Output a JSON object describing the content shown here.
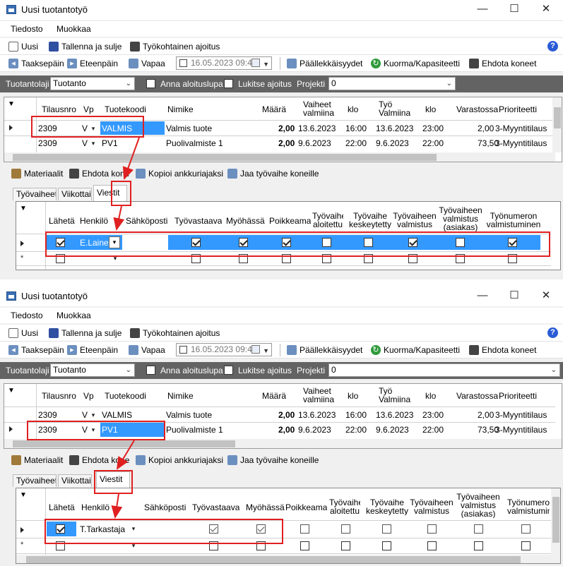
{
  "window": {
    "title": "Uusi tuotantotyö"
  },
  "menu": [
    "Tiedosto",
    "Muokkaa"
  ],
  "toolbar1": {
    "new": "Uusi",
    "save_close": "Tallenna ja sulje",
    "job_run": "Työkohtainen ajoitus"
  },
  "toolbar2": {
    "back": "Taaksepäin",
    "forward": "Eteenpäin",
    "free": "Vapaa",
    "date": "16.05.2023 09:40",
    "overlaps": "Päällekkäisyydet",
    "load": "Kuorma/Kapasiteetti",
    "suggest": "Ehdota koneet"
  },
  "filter": {
    "type_label": "Tuotantolaji",
    "type_value": "Tuotanto",
    "allow_start": "Anna aloituslupa",
    "lock_run": "Lukitse ajoitus",
    "project_label": "Projekti",
    "project_value": "0"
  },
  "main_grid": {
    "headers": {
      "order_no": "Tilausnro",
      "vp": "Vp",
      "product": "Tuotekoodi",
      "name": "Nimike",
      "qty": "Määrä",
      "phase_l1": "Vaiheet",
      "phase_l2": "valmiina",
      "time1": "klo",
      "work_l1": "Työ",
      "work_l2": "Valmiina",
      "time2": "klo",
      "stock": "Varastossa",
      "priority": "Prioriteetti"
    },
    "rows": [
      {
        "order_no": "2309",
        "vp": "V",
        "product": "VALMIS",
        "name": "Valmis tuote",
        "qty": "2,00",
        "phase_done": "13.6.2023",
        "time1": "16:00",
        "work_done": "13.6.2023",
        "time2": "23:00",
        "stock": "2,00",
        "priority": "3-Myyntitilaus"
      },
      {
        "order_no": "2309",
        "vp": "V",
        "product": "PV1",
        "name": "Puolivalmiste 1",
        "qty": "2,00",
        "phase_done": "9.6.2023",
        "time1": "22:00",
        "work_done": "9.6.2023",
        "time2": "22:00",
        "stock": "73,50",
        "priority": "3-Myyntitilaus"
      }
    ]
  },
  "toolbar3": {
    "materials": "Materiaalit",
    "suggest_machine": "Ehdota kone",
    "copy_anchor": "Kopioi ankkuriajaksi",
    "split_phase": "Jaa työvaihe koneille"
  },
  "tabs": [
    "Työvaiheet",
    "Viikottain",
    "Viestit"
  ],
  "msg_grid": {
    "headers": {
      "send": "Lähetä",
      "person": "Henkilö",
      "email": "Sähköposti",
      "responsible": "Työvastaava",
      "late": "Myöhässä",
      "deviation": "Poikkeama",
      "started_l1": "Työvaihe",
      "started_l2": "aloitettu",
      "paused_l1": "Työvaihe",
      "paused_l2": "keskeytetty",
      "done_l1": "Työvaiheen",
      "done_l2": "valmistus",
      "cust_l1": "Työvaiheen",
      "cust_l2": "valmistus",
      "cust_l3": "(asiakas)",
      "wo_l1": "Työnumeron",
      "wo_l2": "valmistuminen",
      "wo_l2_short": "valmistumin"
    }
  },
  "panel1": {
    "person": "E.Laine",
    "checks": [
      true,
      true,
      true,
      true,
      false,
      false,
      true,
      false,
      true
    ]
  },
  "panel2": {
    "person": "T.Tarkastaja",
    "checks": [
      true,
      true,
      true,
      false,
      false,
      false,
      false,
      false,
      false
    ]
  }
}
